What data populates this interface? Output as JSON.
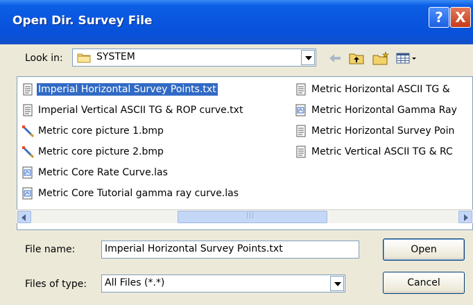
{
  "window": {
    "title": "Open Dir. Survey File",
    "help_label": "?",
    "close_label": "X"
  },
  "lookin": {
    "label": "Look in:",
    "value": "SYSTEM"
  },
  "toolbar": {
    "icons": [
      "back-arrow-icon",
      "up-folder-icon",
      "new-folder-icon",
      "view-menu-icon"
    ]
  },
  "files": {
    "col1": [
      {
        "name": "Imperial Horizontal Survey Points.txt",
        "icon": "text-file-icon",
        "selected": true
      },
      {
        "name": "Imperial Vertical ASCII TG & ROP curve.txt",
        "icon": "text-file-icon"
      },
      {
        "name": "Metric core picture 1.bmp",
        "icon": "bitmap-file-icon"
      },
      {
        "name": "Metric core picture 2.bmp",
        "icon": "bitmap-file-icon"
      },
      {
        "name": "Metric Core Rate Curve.las",
        "icon": "las-file-icon"
      },
      {
        "name": "Metric Core Tutorial gamma ray curve.las",
        "icon": "las-file-icon"
      }
    ],
    "col2": [
      {
        "name": "Metric Horizontal ASCII TG &",
        "icon": "text-file-icon"
      },
      {
        "name": "Metric Horizontal Gamma Ray",
        "icon": "las-file-icon"
      },
      {
        "name": "Metric Horizontal Survey Poin",
        "icon": "text-file-icon"
      },
      {
        "name": "Metric Vertical ASCII TG & RC",
        "icon": "text-file-icon"
      }
    ]
  },
  "filename": {
    "label": "File name:",
    "value": "Imperial Horizontal Survey Points.txt"
  },
  "filetype": {
    "label": "Files of type:",
    "value": "All Files (*.*)"
  },
  "buttons": {
    "open": "Open",
    "cancel": "Cancel"
  },
  "colors": {
    "titlebar": "#0a56df",
    "selection": "#316ac5",
    "dialog_bg": "#ece9d8"
  }
}
